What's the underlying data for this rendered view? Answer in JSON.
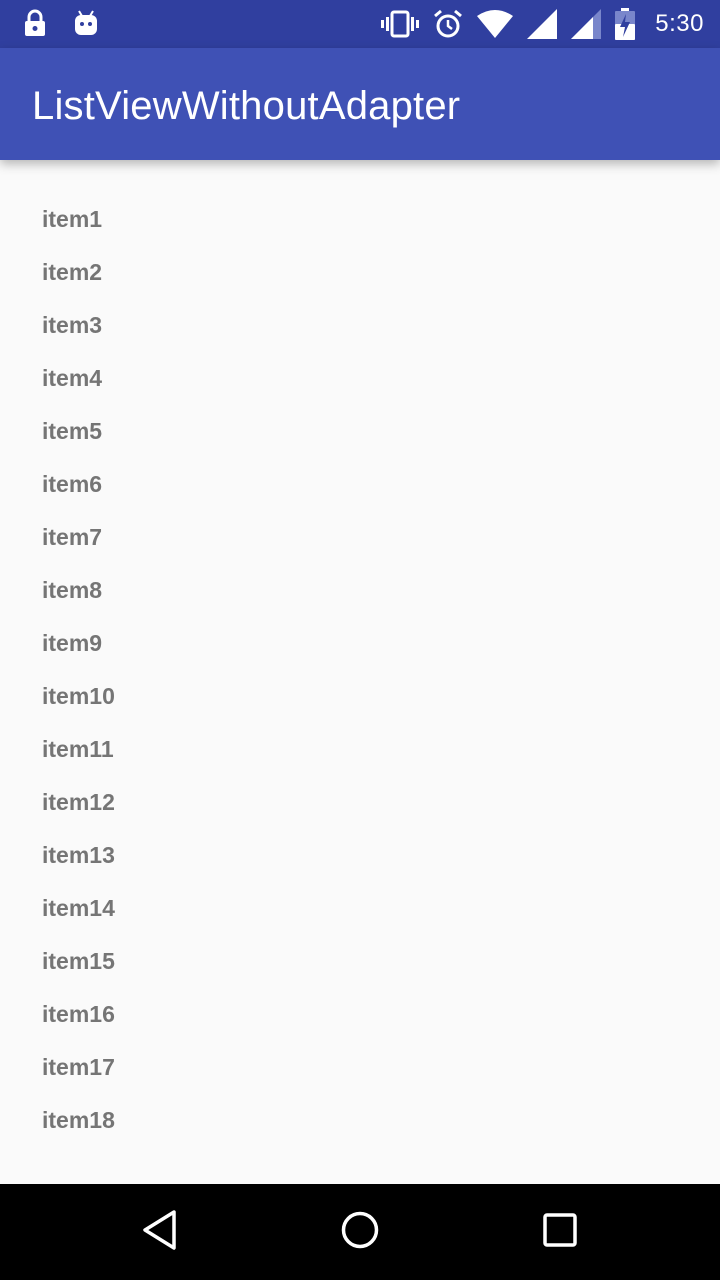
{
  "status_bar": {
    "time": "5:30",
    "left_icons": [
      "lock-icon",
      "android-icon"
    ],
    "right_icons": [
      "vibrate-icon",
      "alarm-icon",
      "wifi-icon",
      "signal-icon",
      "signal-icon-2",
      "battery-charging-icon"
    ]
  },
  "app_bar": {
    "title": "ListViewWithoutAdapter"
  },
  "list": {
    "items": [
      {
        "label": "item1"
      },
      {
        "label": "item2"
      },
      {
        "label": "item3"
      },
      {
        "label": "item4"
      },
      {
        "label": "item5"
      },
      {
        "label": "item6"
      },
      {
        "label": "item7"
      },
      {
        "label": "item8"
      },
      {
        "label": "item9"
      },
      {
        "label": "item10"
      },
      {
        "label": "item11"
      },
      {
        "label": "item12"
      },
      {
        "label": "item13"
      },
      {
        "label": "item14"
      },
      {
        "label": "item15"
      },
      {
        "label": "item16"
      },
      {
        "label": "item17"
      },
      {
        "label": "item18"
      }
    ]
  },
  "nav_bar": {
    "buttons": [
      "back-icon",
      "home-icon",
      "recent-apps-icon"
    ]
  },
  "colors": {
    "status_bar": "#303f9f",
    "app_bar": "#3f51b5",
    "background": "#fafafa",
    "item_text": "#757575",
    "nav_bar": "#000000"
  }
}
